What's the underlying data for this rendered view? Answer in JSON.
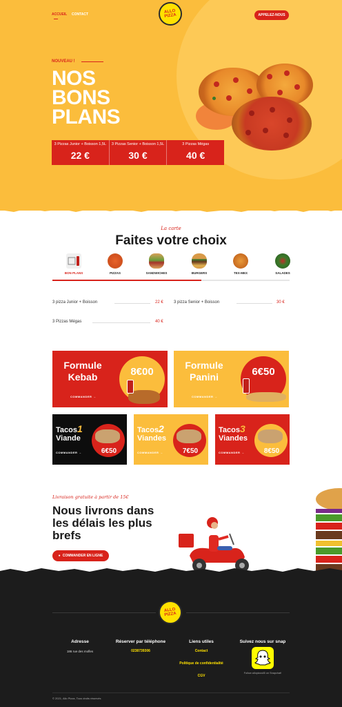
{
  "nav": {
    "accueil": "ACCUEIL",
    "contact": "CONTACT",
    "cta": "APPELEZ-NOUS"
  },
  "logo": {
    "line1": "ALLO",
    "line2": "PIZZA"
  },
  "hero": {
    "tag": "NOUVEAU !",
    "title_l1": "NOS",
    "title_l2": "BONS",
    "title_l3": "PLANS",
    "deals": [
      {
        "title": "3 Pizzas Junior + Boisson 1,5L",
        "price": "22 €"
      },
      {
        "title": "3 Pizzas Senior + Boisson 1,5L",
        "price": "30 €"
      },
      {
        "title": "3 Pizzas Mégas",
        "price": "40 €"
      }
    ]
  },
  "menu": {
    "label": "La carte",
    "title": "Faites votre choix",
    "categories": [
      {
        "label": "BON PLANS",
        "icon": "bon-plans-icon"
      },
      {
        "label": "PIZZAS",
        "icon": "pizza-icon"
      },
      {
        "label": "SANDWICHES",
        "icon": "sandwich-icon"
      },
      {
        "label": "BURGERS",
        "icon": "burger-icon"
      },
      {
        "label": "TEX-MEX",
        "icon": "texmex-icon"
      },
      {
        "label": "SALADES",
        "icon": "salad-icon"
      }
    ],
    "items": [
      {
        "name": "3 pizza Junior + Boisson",
        "price": "22 €"
      },
      {
        "name": "3 pizza Senior + Boisson",
        "price": "30 €"
      },
      {
        "name": "3 Pizzas Mégas",
        "price": "40 €"
      }
    ]
  },
  "promos": {
    "commander": "COMMANDER →",
    "kebab": {
      "l1": "Formule",
      "l2": "Kebab",
      "price": "8€00"
    },
    "panini": {
      "l1": "Formule",
      "l2": "Panini",
      "price": "6€50"
    },
    "tacos1": {
      "l1": "Tacos",
      "n": "1",
      "l2": "Viande",
      "price": "6€50"
    },
    "tacos2": {
      "l1": "Tacos",
      "n": "2",
      "l2": "Viandes",
      "price": "7€50"
    },
    "tacos3": {
      "l1": "Tacos",
      "n": "3",
      "l2": "Viandes",
      "price": "8€50"
    }
  },
  "delivery": {
    "label": "Livraison gratuite à partir de 15€",
    "title_l1": "Nous livrons dans",
    "title_l2": "les délais les plus",
    "title_l3": "brefs",
    "cta": "COMMANDER EN LIGNE"
  },
  "footer": {
    "address": {
      "title": "Adresse",
      "text": "186 rue des mofles"
    },
    "phone": {
      "title": "Réserver par téléphone",
      "number": "0238739306"
    },
    "links": {
      "title": "Liens utiles",
      "contact": "Contact",
      "privacy": "Politique de confidentialité",
      "cgv": "CGV"
    },
    "snap": {
      "title": "Suivez nous sur snap",
      "caption": "Follow allopizza45 on Snapchat!"
    },
    "copyright": "© 2021, Allo Pizza, Tous droits réservés"
  },
  "colors": {
    "brand_yellow": "#fbbd3c",
    "brand_red": "#d8231b",
    "footer_bg": "#1c1c1c",
    "accent_yellow": "#ffe100"
  }
}
